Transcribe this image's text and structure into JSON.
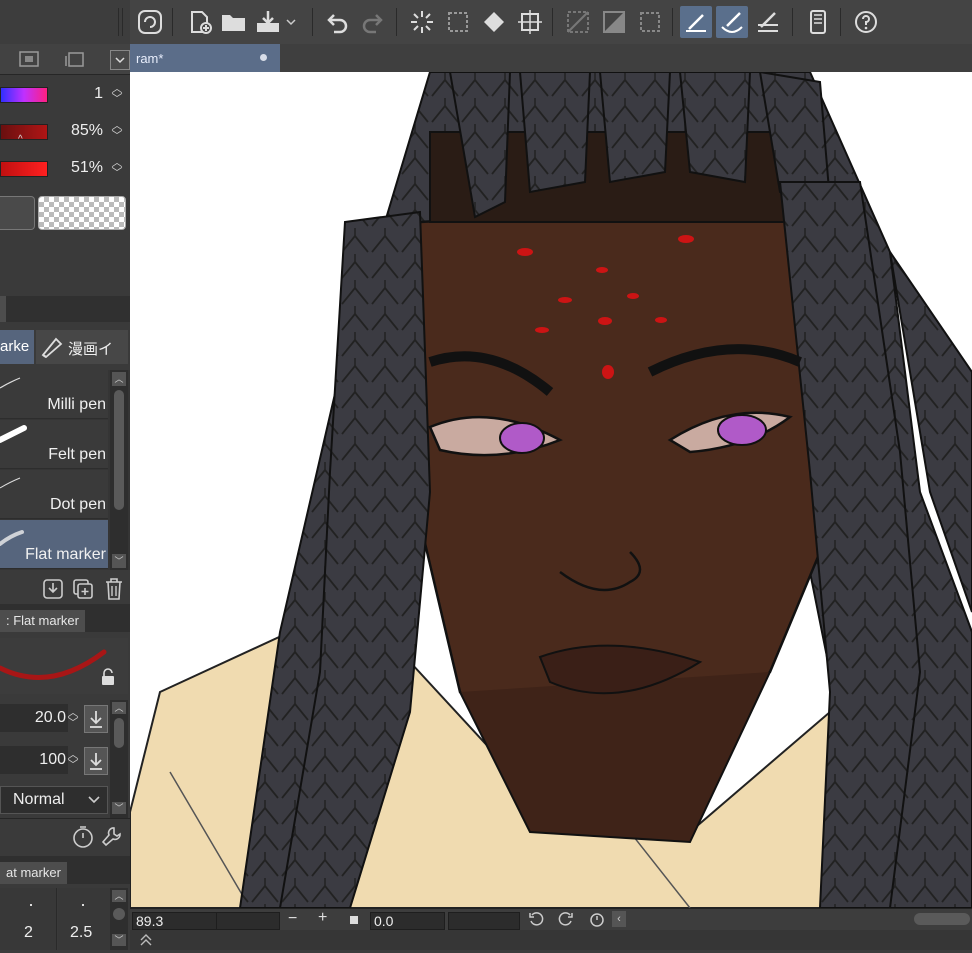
{
  "document": {
    "tab_title": "ram*"
  },
  "color_panel": {
    "hue_value": "1",
    "saturation_value": "85%",
    "brightness_value": "51%"
  },
  "sub_tool_tabs": {
    "active": "arke",
    "second": "漫画イ"
  },
  "brushes": [
    {
      "label": "Milli pen",
      "selected": false
    },
    {
      "label": "Felt pen",
      "selected": false
    },
    {
      "label": "Dot pen",
      "selected": false
    },
    {
      "label": "Flat marker",
      "selected": true
    }
  ],
  "tool_property": {
    "tab_title": ": Flat marker",
    "brush_size": "20.0",
    "opacity": "100",
    "blend_mode": "Normal"
  },
  "brush_size_panel": {
    "tab_title": "at marker",
    "sizes": [
      "2",
      "2.5"
    ]
  },
  "status": {
    "zoom": "89.3",
    "rotation": "0.0",
    "minus": "−",
    "plus": "+"
  },
  "colors": {
    "accent": "#5a6f8c",
    "skin": "#4a2a1c",
    "hair": "#3b3b42",
    "cloth": "#f0dbb0",
    "eye": "#b05ac8",
    "dots": "#cc1414"
  }
}
